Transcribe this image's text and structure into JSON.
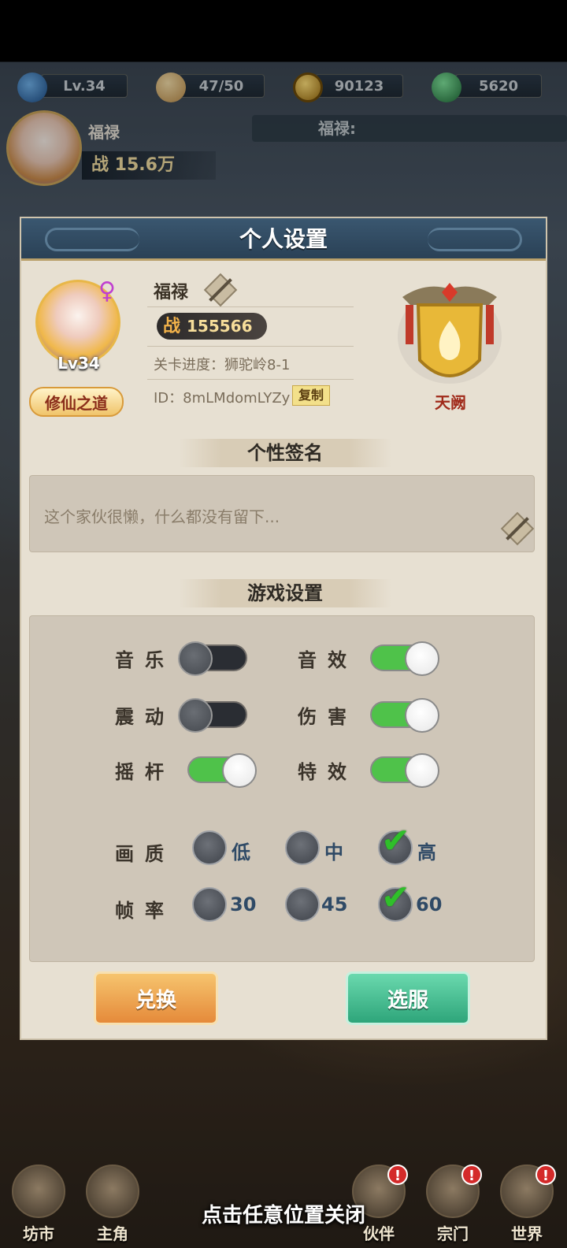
{
  "resources": [
    {
      "icon": "level-icon",
      "value": "Lv.34"
    },
    {
      "icon": "bun-icon",
      "value": "47/50"
    },
    {
      "icon": "coin-icon",
      "value": "90123"
    },
    {
      "icon": "jade-icon",
      "value": "5620"
    }
  ],
  "header": {
    "name": "福禄",
    "power": "战 15.6万",
    "chat": "福禄: "
  },
  "modal": {
    "title": "个人设置",
    "player": {
      "name": "福禄",
      "power_prefix": "战",
      "power_value": "155566",
      "level": "Lv34",
      "dao": "修仙之道",
      "stage": "关卡进度：狮驼岭8-1",
      "id": "ID：8mLMdomLYZy",
      "copy_label": "复制",
      "sect_name": "天阙"
    },
    "signature": {
      "header": "个性签名",
      "text": "这个家伙很懒，什么都没有留下..."
    },
    "settings": {
      "header": "游戏设置",
      "toggles": [
        {
          "label": "音乐",
          "on": false
        },
        {
          "label": "音效",
          "on": true
        },
        {
          "label": "震动",
          "on": false
        },
        {
          "label": "伤害",
          "on": true
        },
        {
          "label": "摇杆",
          "on": true
        },
        {
          "label": "特效",
          "on": true
        }
      ],
      "quality": {
        "label": "画质",
        "options": [
          "低",
          "中",
          "高"
        ],
        "selected": "高"
      },
      "framerate": {
        "label": "帧率",
        "options": [
          "30",
          "45",
          "60"
        ],
        "selected": "60"
      }
    },
    "buttons": {
      "exchange": "兑换",
      "select_server": "选服"
    }
  },
  "bottom_nav": [
    {
      "label": "坊市",
      "badge": ""
    },
    {
      "label": "主角",
      "badge": ""
    },
    {
      "label": "伙伴",
      "badge": "!"
    },
    {
      "label": "宗门",
      "badge": "!"
    },
    {
      "label": "世界",
      "badge": "!"
    }
  ],
  "close_hint": "点击任意位置关闭",
  "colors": {
    "title_bar": "#2e4a62",
    "toggle_on": "#4fc24a",
    "toggle_off": "#2a2d33",
    "check": "#2fbf2a",
    "exchange_button": "#e58a3a",
    "server_button": "#2ea57a"
  }
}
